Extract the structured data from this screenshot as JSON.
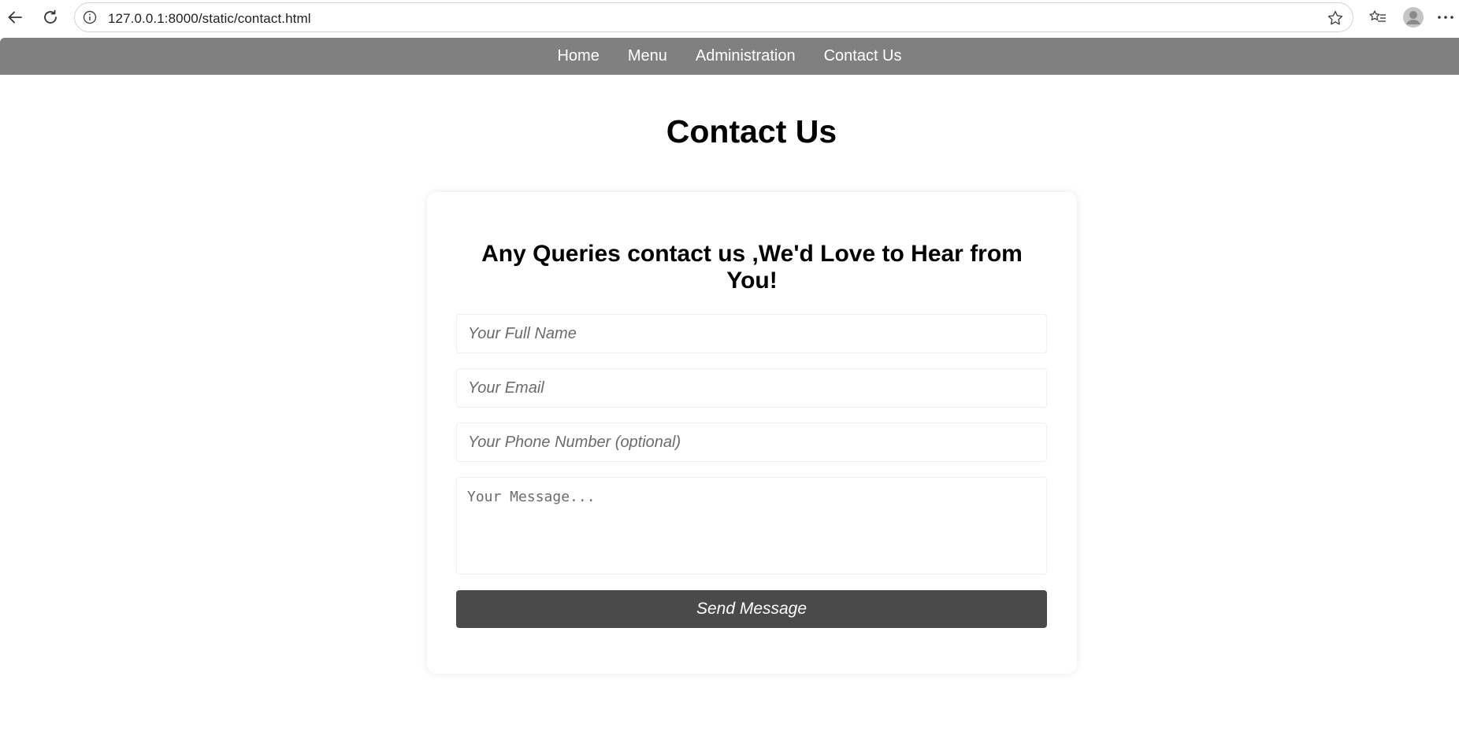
{
  "browser": {
    "url": "127.0.0.1:8000/static/contact.html"
  },
  "nav": {
    "items": [
      {
        "label": "Home"
      },
      {
        "label": "Menu"
      },
      {
        "label": "Administration"
      },
      {
        "label": "Contact Us"
      }
    ],
    "background_color": "#808080"
  },
  "page": {
    "title": "Contact Us"
  },
  "form": {
    "heading": "Any Queries contact us ,We'd Love to Hear from You!",
    "name_placeholder": "Your Full Name",
    "email_placeholder": "Your Email",
    "phone_placeholder": "Your Phone Number (optional)",
    "message_placeholder": "Your Message...",
    "submit_label": "Send Message",
    "submit_color": "#4a4a4a"
  }
}
